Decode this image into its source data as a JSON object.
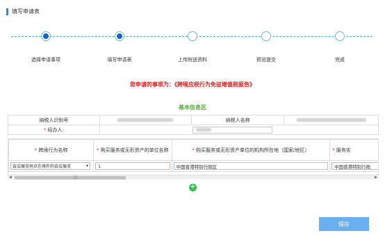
{
  "section": {
    "title": "填写申请表"
  },
  "steps": [
    {
      "label": "选择申请事项",
      "done": true
    },
    {
      "label": "填写申请表",
      "done": true
    },
    {
      "label": "上传附送资料",
      "done": false
    },
    {
      "label": "预览提交",
      "done": false
    },
    {
      "label": "完成",
      "done": false
    }
  ],
  "notice": {
    "prefix": "您申请的事项为：",
    "item": "《跨境应税行为免征增值税报告》"
  },
  "basic_info": {
    "title": "基本信息区",
    "taxpayer_id_label": "纳税人识别号",
    "taxpayer_name_label": "纳税人名称",
    "agent_label": "经办人:"
  },
  "grid": {
    "headers": [
      "跨境行为名称",
      "购买服务或无形资产的单位名称",
      "购买服务或无形资产单位的机构所在地（国家/地区）",
      "服务实"
    ],
    "rows": [
      {
        "behavior": "会议展览地点在境外的会议展览",
        "unit_name": "1",
        "location": "中国香港特别行政区",
        "service_place": "中国香港特别行政"
      }
    ]
  },
  "actions": {
    "save_label": "保存"
  },
  "colors": {
    "accent": "#1e88e5",
    "notice_red": "#e02020",
    "section_green": "#5aa93a",
    "add_green": "#2fbf4a",
    "save_blue": "#6aaff0"
  }
}
